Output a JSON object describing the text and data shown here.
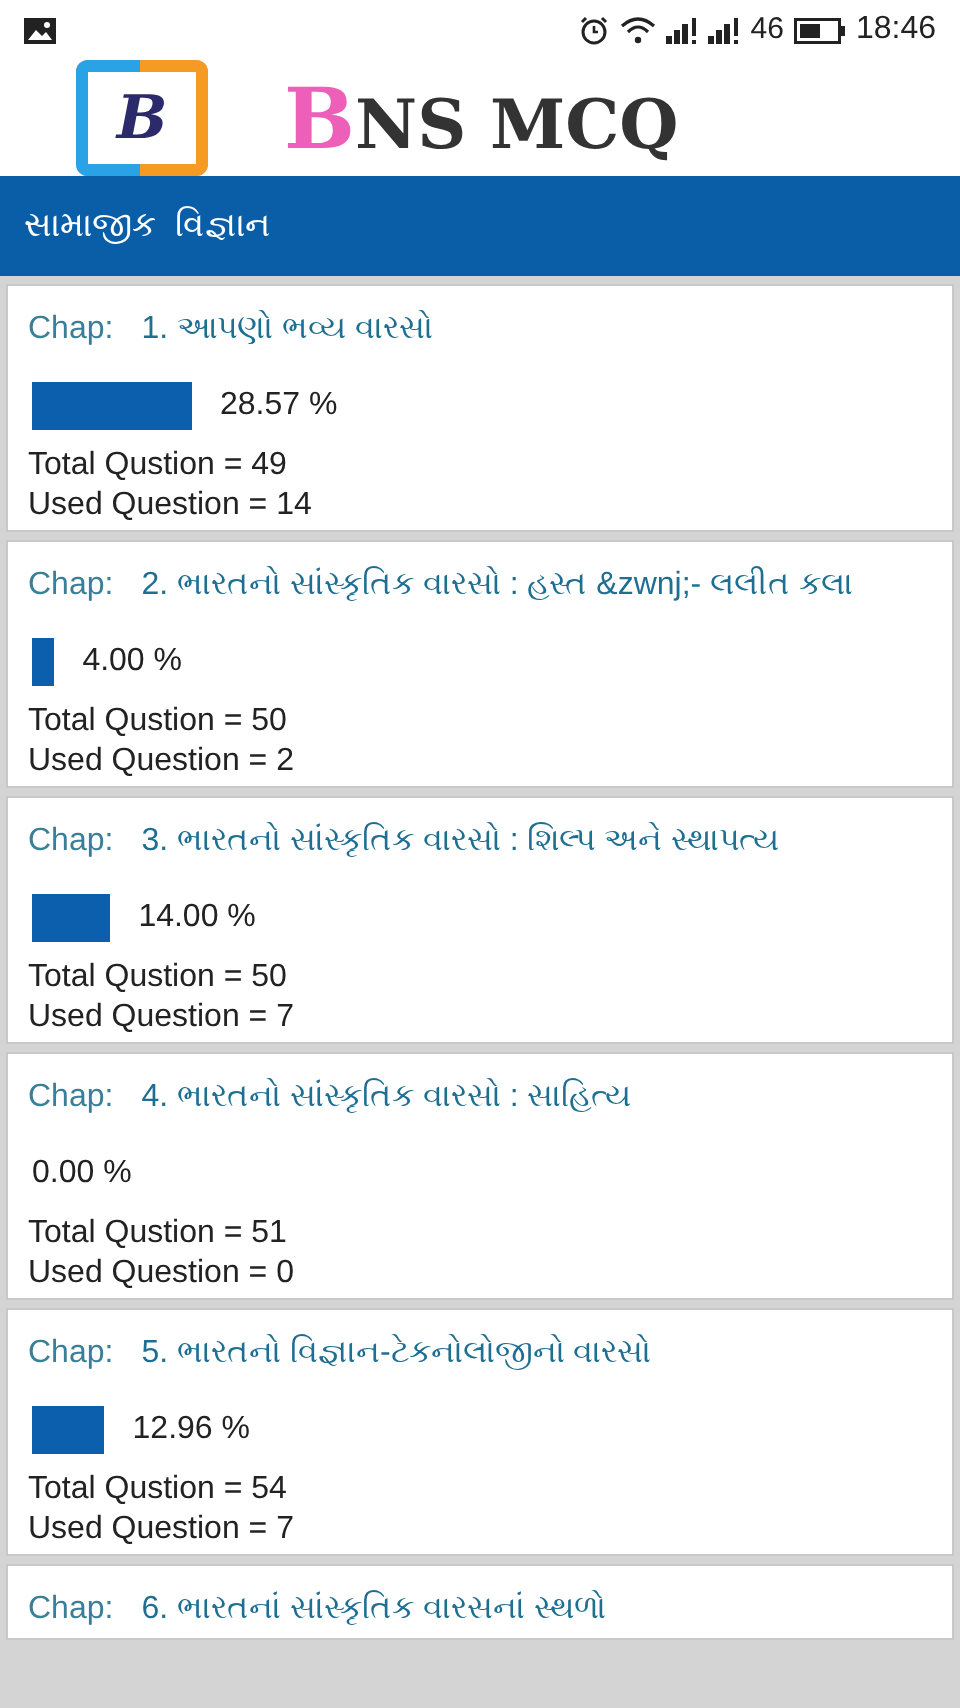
{
  "status_bar": {
    "network": "46",
    "time": "18:46"
  },
  "header": {
    "logo_letter": "B",
    "app_name": "BNS MCQ"
  },
  "section_bar": {
    "title": "સામાજીક  વિજ્ઞાન"
  },
  "chapters": [
    {
      "label": "Chap:",
      "title": "1. આપણો ભવ્ય વારસો",
      "percent": "28.57 %",
      "total": "Total Qustion = 49",
      "used": "Used Question = 14"
    },
    {
      "label": "Chap:",
      "title": "2. ભારતનો સાંસ્કૃતિક વારસો : હસ્ત &zwnj;- લલીત કલા",
      "percent": "4.00 %",
      "total": "Total Qustion = 50",
      "used": "Used Question = 2"
    },
    {
      "label": "Chap:",
      "title": "3. ભારતનો સાંસ્કૃતિક વારસો : શિલ્પ અને સ્થાપત્ય",
      "percent": "14.00 %",
      "total": "Total Qustion = 50",
      "used": "Used Question = 7"
    },
    {
      "label": "Chap:",
      "title": "4. ભારતનો સાંસ્કૃતિક વારસો : સાહિત્ય",
      "percent": "0.00 %",
      "total": "Total Qustion = 51",
      "used": "Used Question = 0"
    },
    {
      "label": "Chap:",
      "title": "5. ભારતનો વિજ્ઞાન-ટેકનોલોજીનો વારસો",
      "percent": "12.96 %",
      "total": "Total Qustion = 54",
      "used": "Used Question = 7"
    },
    {
      "label": "Chap:",
      "title": "6. ભારતનાં સાંસ્કૃતિક વારસનાં સ્થળો"
    }
  ]
}
